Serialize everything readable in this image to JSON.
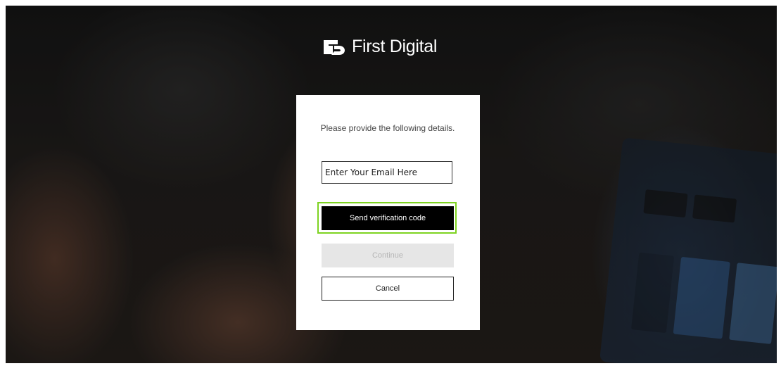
{
  "brand": {
    "name": "First Digital",
    "accent_color": "#7ed321"
  },
  "form": {
    "instructions": "Please provide the following details.",
    "email": {
      "placeholder": "Enter Your Email Here",
      "value": ""
    },
    "send_code_label": "Send verification code",
    "continue_label": "Continue",
    "cancel_label": "Cancel"
  }
}
